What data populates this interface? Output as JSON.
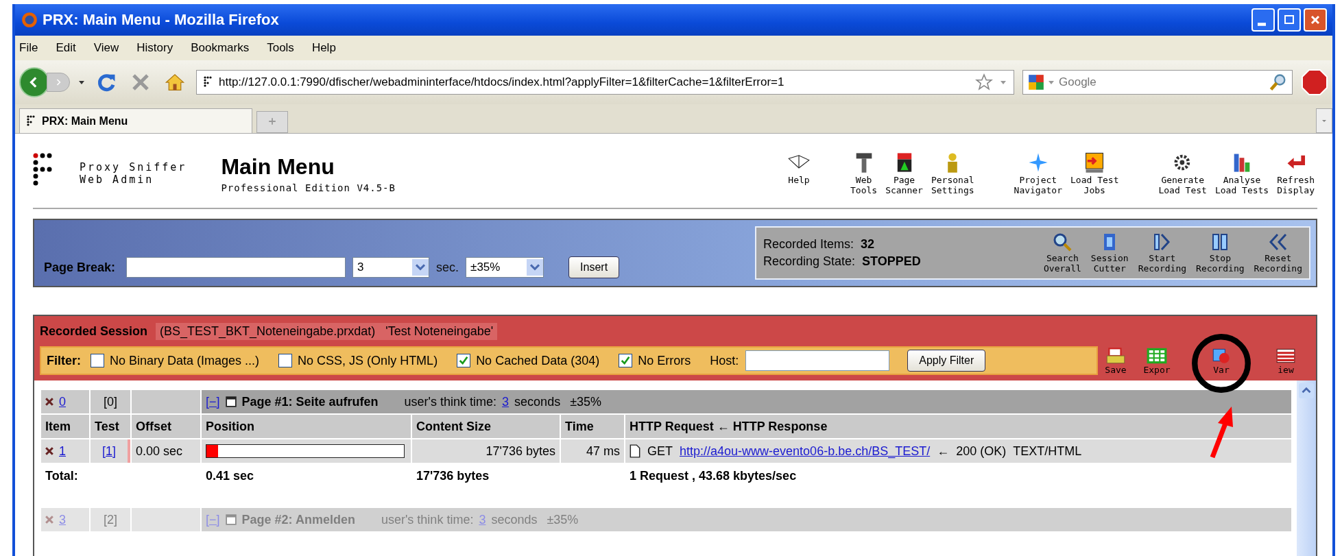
{
  "window": {
    "title": "PRX: Main Menu - Mozilla Firefox"
  },
  "menu_bar": [
    "File",
    "Edit",
    "View",
    "History",
    "Bookmarks",
    "Tools",
    "Help"
  ],
  "address_bar": {
    "url": "http://127.0.0.1:7990/dfischer/webadmininterface/htdocs/index.html?applyFilter=1&filterCache=1&filterError=1"
  },
  "search_field": {
    "placeholder": "Google"
  },
  "tabs": [
    {
      "label": "PRX: Main Menu",
      "selected": true
    }
  ],
  "header": {
    "product": [
      "Proxy Sniffer",
      "Web Admin"
    ],
    "title": "Main Menu",
    "edition": "Professional Edition V4.5-B"
  },
  "toolbar_groups": [
    [
      {
        "lines": [
          "Help"
        ]
      }
    ],
    [
      {
        "lines": [
          "Web",
          "Tools"
        ]
      },
      {
        "lines": [
          "Page",
          "Scanner"
        ]
      },
      {
        "lines": [
          "Personal",
          "Settings"
        ]
      }
    ],
    [
      {
        "lines": [
          "Project",
          "Navigator"
        ]
      },
      {
        "lines": [
          "Load Test",
          "Jobs"
        ]
      }
    ],
    [
      {
        "lines": [
          "Generate",
          "Load Test"
        ]
      },
      {
        "lines": [
          "Analyse",
          "Load Tests"
        ]
      },
      {
        "lines": [
          "Refresh",
          "Display"
        ]
      }
    ]
  ],
  "page_break": {
    "label": "Page Break:",
    "delay": "3",
    "unit": "sec.",
    "variance": "±35%",
    "button": "Insert"
  },
  "recording": {
    "items_label": "Recorded Items:",
    "items": "32",
    "state_label": "Recording State:",
    "state": "STOPPED",
    "actions": [
      {
        "lines": [
          "Search",
          "Overall"
        ]
      },
      {
        "lines": [
          "Session",
          "Cutter"
        ]
      },
      {
        "lines": [
          "Start",
          "Recording"
        ]
      },
      {
        "lines": [
          "Stop",
          "Recording"
        ]
      },
      {
        "lines": [
          "Reset",
          "Recording"
        ]
      }
    ]
  },
  "session": {
    "label": "Recorded Session",
    "file": "(BS_TEST_BKT_Noteneingabe.prxdat)",
    "name": "'Test Noteneingabe'"
  },
  "filter": {
    "label": "Filter:",
    "options": [
      {
        "label": "No Binary Data (Images ...)",
        "checked": false
      },
      {
        "label": "No CSS, JS (Only HTML)",
        "checked": false
      },
      {
        "label": "No Cached Data (304)",
        "checked": true
      },
      {
        "label": "No Errors",
        "checked": true
      }
    ],
    "host_label": "Host:",
    "button": "Apply Filter"
  },
  "session_actions": [
    "Save",
    "Expor",
    "Var",
    "iew"
  ],
  "pages": [
    {
      "faded": false,
      "item": "0",
      "test": "[0]",
      "toggle": "[−]",
      "title": "Page #1: Seite aufrufen",
      "think_label": "user's think time:",
      "think": "3",
      "think_unit": "seconds",
      "variance": "±35%",
      "columns": [
        "Item",
        "Test",
        "Offset",
        "Position",
        "Content Size",
        "Time",
        "HTTP Request ← HTTP Response"
      ],
      "rows": [
        {
          "item": "1",
          "test": "[1]",
          "offset": "0.00 sec",
          "level": 0.06,
          "size": "17'736 bytes",
          "time": "47 ms",
          "method": "GET",
          "url": "http://a4ou-www-evento06-b.be.ch/BS_TEST/",
          "arrow": "←",
          "status": "200 (OK)",
          "type": "TEXT/HTML"
        }
      ],
      "total": {
        "label": "Total:",
        "position": "0.41 sec",
        "size": "17'736 bytes",
        "throughput": "1 Request , 43.68 kbytes/sec"
      }
    },
    {
      "faded": true,
      "item": "3",
      "test": "[2]",
      "toggle": "[−]",
      "title": "Page #2: Anmelden",
      "think_label": "user's think time:",
      "think": "3",
      "think_unit": "seconds",
      "variance": "±35%"
    }
  ]
}
